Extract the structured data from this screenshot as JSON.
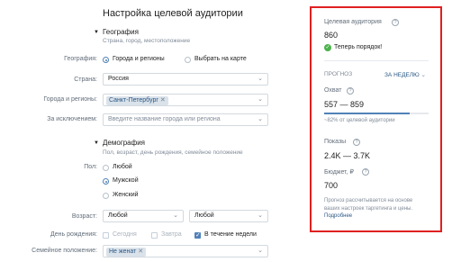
{
  "page": {
    "title": "Настройка целевой аудитории"
  },
  "geography": {
    "section_title": "География",
    "section_hint": "Страна, город, местоположение",
    "geo_label": "География:",
    "geo_option_regions": "Города и регионы",
    "geo_option_map": "Выбрать на карте",
    "country_label": "Страна:",
    "country_value": "Россия",
    "cities_label": "Города и регионы:",
    "cities_tag": "Санкт-Петербург",
    "exclude_label": "За исключением:",
    "exclude_placeholder": "Введите название города или региона"
  },
  "demography": {
    "section_title": "Демография",
    "section_hint": "Пол, возраст, день рождения, семейное положение",
    "gender_label": "Пол:",
    "gender_any": "Любой",
    "gender_male": "Мужской",
    "gender_female": "Женский",
    "age_label": "Возраст:",
    "age_from": "Любой",
    "age_to": "Любой",
    "birthday_label": "День рождения:",
    "birthday_today": "Сегодня",
    "birthday_tomorrow": "Завтра",
    "birthday_week": "В течение недели",
    "marital_label": "Семейное положение:",
    "marital_tag": "Не женат"
  },
  "panel": {
    "audience_label": "Целевая аудитория",
    "audience_value": "860",
    "audience_status": "Теперь порядок!",
    "forecast_label": "ПРОГНОЗ",
    "period_select": "ЗА НЕДЕЛЮ",
    "reach_label": "Охват",
    "reach_value": "557 — 859",
    "reach_progress": 0.82,
    "reach_hint": "~82% от целевой аудитории",
    "impressions_label": "Показы",
    "impressions_value": "2.4K — 3.7K",
    "budget_label": "Бюджет, ₽",
    "budget_value": "700",
    "footnote": "Прогноз рассчитывается на основе ваших настроек таргетинга и цены.",
    "footnote_link": "Подробнее"
  },
  "colors": {
    "accent": "#5181b8",
    "highlight_border": "#e02020",
    "success": "#4bb34b"
  }
}
